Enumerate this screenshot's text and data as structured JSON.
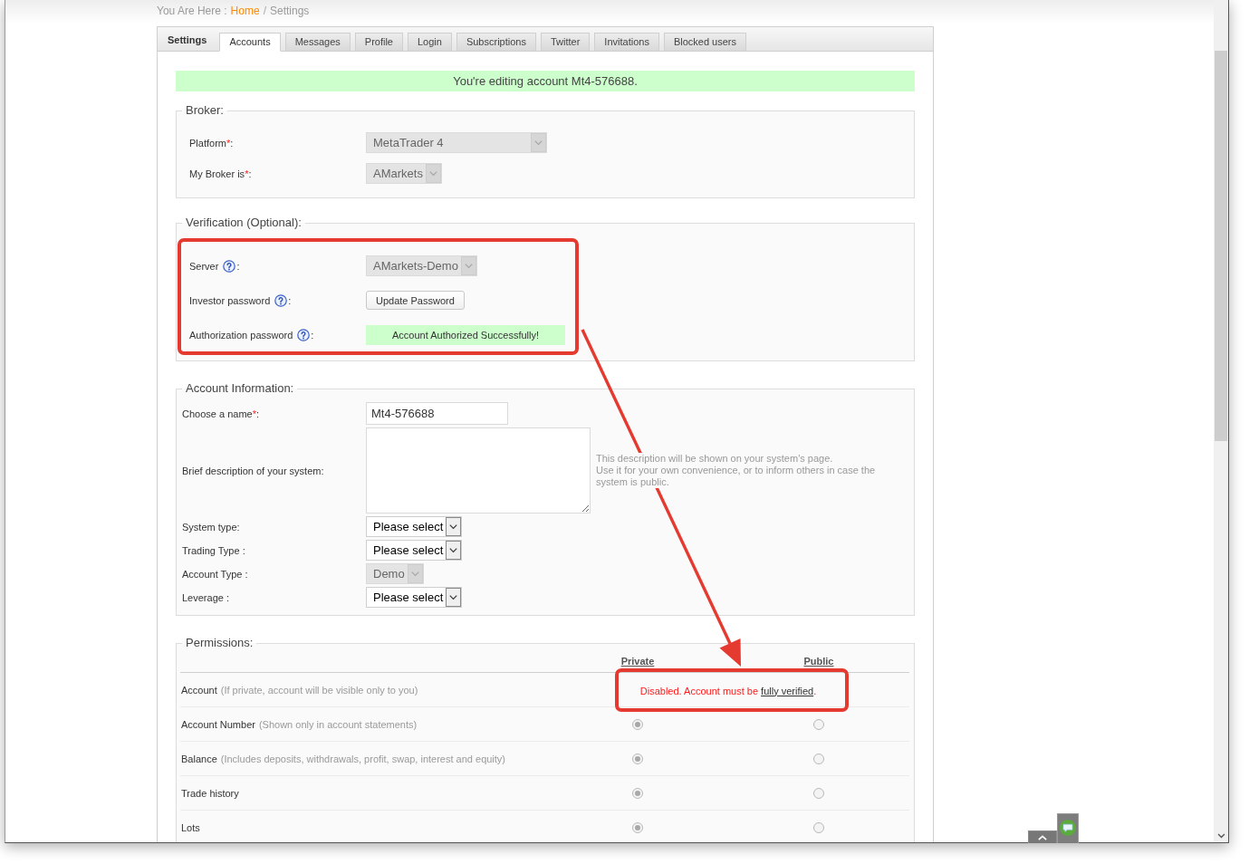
{
  "breadcrumb": {
    "prefix": "You Are Here :",
    "separator": "/",
    "links": [
      {
        "label": "Home",
        "link": true
      },
      {
        "label": "Settings",
        "link": false
      }
    ]
  },
  "tabs": {
    "heading": "Settings",
    "items": [
      {
        "label": "Accounts",
        "selected": true
      },
      {
        "label": "Messages",
        "selected": false
      },
      {
        "label": "Profile",
        "selected": false
      },
      {
        "label": "Login",
        "selected": false
      },
      {
        "label": "Subscriptions",
        "selected": false
      },
      {
        "label": "Twitter",
        "selected": false
      },
      {
        "label": "Invitations",
        "selected": false
      },
      {
        "label": "Blocked users",
        "selected": false
      }
    ]
  },
  "notice": "You're editing account Mt4-576688.",
  "sections": [
    {
      "kind": "form",
      "legend": "Broker:",
      "rows": [
        {
          "kind": "dropdown",
          "label": "Platform",
          "required_mark": "*",
          "label_end": ":",
          "value": "MetaTrader 4",
          "disabled": true
        },
        {
          "kind": "dropdown",
          "label": "My Broker is",
          "required_mark": "*",
          "label_end": ":",
          "value": "AMarkets",
          "disabled": true
        }
      ]
    },
    {
      "kind": "form",
      "legend": "Verification (Optional):",
      "rows": [
        {
          "kind": "dropdown",
          "label": "Server",
          "help": true,
          "label_end": ":",
          "value": "AMarkets-Demo",
          "disabled": true
        },
        {
          "kind": "button",
          "label": "Investor password",
          "help": true,
          "label_end": ":",
          "value": "Update Password"
        },
        {
          "kind": "status",
          "label": "Authorization password",
          "help": true,
          "label_end": ":",
          "value": "Account Authorized Successfully!"
        }
      ]
    },
    {
      "kind": "form",
      "legend": "Account Information:",
      "rows": [
        {
          "kind": "text_input",
          "label": "Choose a name",
          "required_mark": "*",
          "label_end": ":",
          "value": "Mt4-576688"
        },
        {
          "kind": "textarea",
          "label": "Brief description of your system:",
          "hint": [
            "This description will be shown on your system's page.",
            "Use it for your own convenience, or to inform others in case the system is public."
          ]
        },
        {
          "kind": "dropdown",
          "label": "System type:",
          "value": "Please select",
          "disabled": false
        },
        {
          "kind": "dropdown",
          "label": "Trading Type :",
          "value": "Please select",
          "disabled": false
        },
        {
          "kind": "dropdown",
          "label": "Account Type :",
          "value": "Demo",
          "disabled": true
        },
        {
          "kind": "dropdown",
          "label": "Leverage :",
          "value": "Please select",
          "disabled": false
        }
      ]
    },
    {
      "kind": "permissions",
      "legend": "Permissions:",
      "columns": [
        "Private",
        "Public"
      ],
      "rows": [
        {
          "kind": "message",
          "name": "Account",
          "note": "(If private, account will be visible only to you)",
          "message": {
            "text": "Disabled. Account must be",
            "link": "fully verified",
            "end": "."
          }
        },
        {
          "kind": "radios",
          "name": "Account Number",
          "note": "(Shown only in account statements)",
          "options": [
            {
              "selected": true,
              "disabled": true
            },
            {
              "selected": false,
              "disabled": true
            }
          ]
        },
        {
          "kind": "radios",
          "name": "Balance",
          "note": "(Includes deposits, withdrawals, profit, swap, interest and equity)",
          "options": [
            {
              "selected": true,
              "disabled": true
            },
            {
              "selected": false,
              "disabled": true
            }
          ]
        },
        {
          "kind": "radios",
          "name": "Trade history",
          "options": [
            {
              "selected": true,
              "disabled": true
            },
            {
              "selected": false,
              "disabled": true
            }
          ]
        },
        {
          "kind": "radios",
          "name": "Lots",
          "options": [
            {
              "selected": true,
              "disabled": true
            },
            {
              "selected": false,
              "disabled": true
            }
          ]
        }
      ]
    }
  ]
}
